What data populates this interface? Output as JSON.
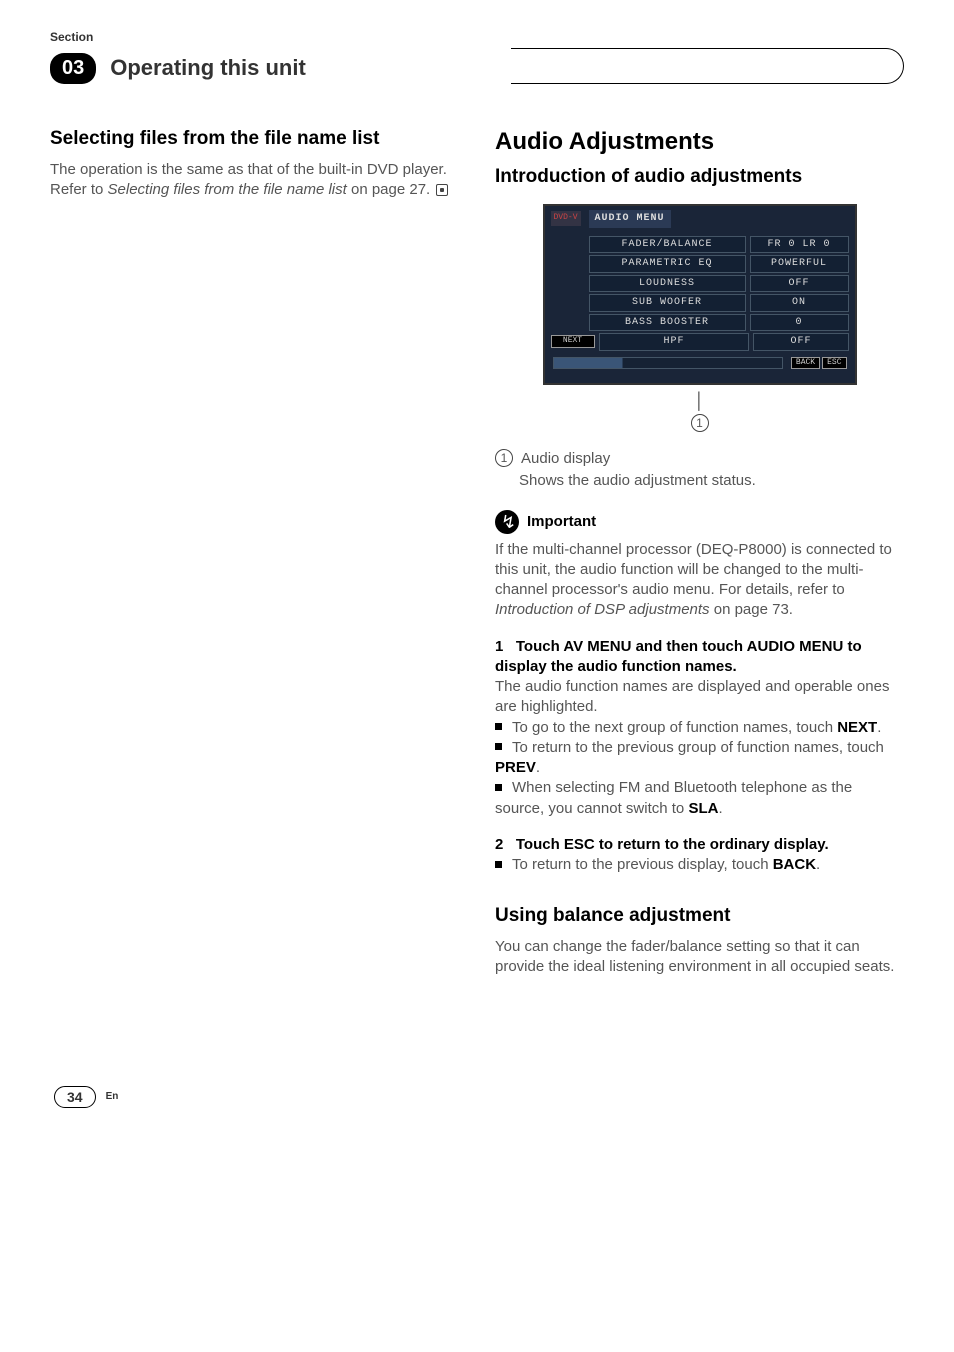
{
  "header": {
    "section_label": "Section",
    "chapter_num": "03",
    "chapter_title": "Operating this unit"
  },
  "left": {
    "heading": "Selecting files from the file name list",
    "p1": "The operation is the same as that of the built-in DVD player.",
    "p2a": "Refer to ",
    "p2_italic": "Selecting files from the file name list",
    "p2b": " on page 27."
  },
  "right": {
    "main_heading": "Audio Adjustments",
    "sub_heading": "Introduction of audio adjustments",
    "screenshot": {
      "source_label": "DVD-V",
      "title": "AUDIO MENU",
      "rows": [
        {
          "label": "FADER/BALANCE",
          "value": "FR 0 LR 0"
        },
        {
          "label": "PARAMETRIC EQ",
          "value": "POWERFUL"
        },
        {
          "label": "LOUDNESS",
          "value": "OFF"
        },
        {
          "label": "SUB WOOFER",
          "value": "ON"
        },
        {
          "label": "BASS BOOSTER",
          "value": "0"
        },
        {
          "label": "HPF",
          "value": "OFF"
        }
      ],
      "side_button": "NEXT",
      "back": "BACK",
      "esc": "ESC"
    },
    "callout_num": "1",
    "item_num": "1",
    "item_label": "Audio display",
    "item_desc": "Shows the audio adjustment status.",
    "important_label": "Important",
    "important_text_a": "If the multi-channel processor (DEQ-P8000) is connected to this unit, the audio function will be changed to the multi-channel processor's audio menu. For details, refer to ",
    "important_italic": "Introduction of DSP adjustments",
    "important_text_b": " on page 73.",
    "step1_num": "1",
    "step1_text": "Touch AV MENU and then touch AUDIO MENU to display the audio function names.",
    "step1_p": "The audio function names are displayed and operable ones are highlighted.",
    "step1_b1a": "To go to the next group of function names, touch ",
    "step1_b1_bold": "NEXT",
    "step1_b1b": ".",
    "step1_b2a": "To return to the previous group of function names, touch ",
    "step1_b2_bold": "PREV",
    "step1_b2b": ".",
    "step1_b3a": "When selecting FM and Bluetooth telephone as the source, you cannot switch to ",
    "step1_b3_bold": "SLA",
    "step1_b3b": ".",
    "step2_num": "2",
    "step2_text": "Touch ESC to return to the ordinary display.",
    "step2_b1a": "To return to the previous display, touch ",
    "step2_b1_bold": "BACK",
    "step2_b1b": ".",
    "balance_heading": "Using balance adjustment",
    "balance_p": "You can change the fader/balance setting so that it can provide the ideal listening environment in all occupied seats."
  },
  "footer": {
    "page_num": "34",
    "lang": "En"
  }
}
